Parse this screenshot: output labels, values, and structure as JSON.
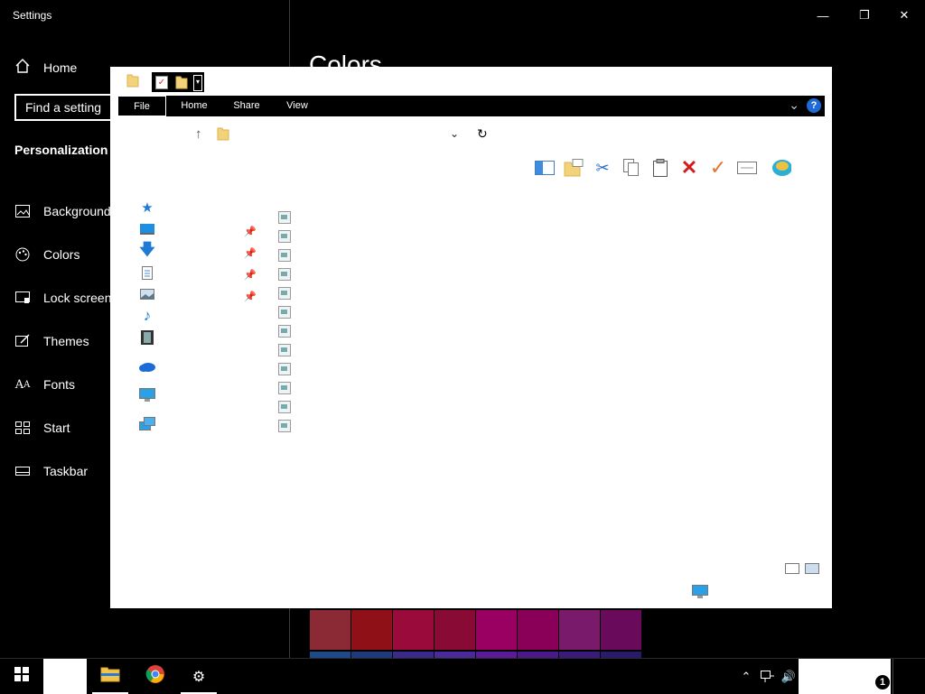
{
  "settings": {
    "title": "Settings",
    "home_label": "Home",
    "search_placeholder": "Find a setting",
    "section": "Personalization",
    "nav": [
      {
        "label": "Background",
        "icon": "image-icon"
      },
      {
        "label": "Colors",
        "icon": "palette-icon"
      },
      {
        "label": "Lock screen",
        "icon": "lock-screen-icon"
      },
      {
        "label": "Themes",
        "icon": "themes-icon"
      },
      {
        "label": "Fonts",
        "icon": "fonts-icon"
      },
      {
        "label": "Start",
        "icon": "start-icon"
      },
      {
        "label": "Taskbar",
        "icon": "taskbar-icon"
      }
    ],
    "page_heading": "Colors",
    "swatch_colors": [
      "#8b2a35",
      "#901018",
      "#9a0a3a",
      "#8a0a36",
      "#9a0062",
      "#8a0058",
      "#7a1a6a",
      "#6a0a5a"
    ],
    "swatch_colors_row2": [
      "#1e4a8a",
      "#1e3a7a",
      "#3a2a8a",
      "#4a2a9a",
      "#5a1a9a",
      "#4a1a8a",
      "#3a1a7a",
      "#2a1a6a"
    ]
  },
  "explorer": {
    "tabs": [
      "File",
      "Home",
      "Share",
      "View"
    ],
    "active_tab": "File",
    "help_label": "?",
    "toolbar_icons": [
      "navigation-pane-icon",
      "new-folder-icon",
      "cut-icon",
      "copy-icon",
      "paste-icon",
      "delete-icon",
      "checkmark-icon",
      "rename-icon",
      "shell-icon"
    ],
    "nav_items": [
      "quick-access-icon",
      "desktop-icon",
      "downloads-icon",
      "documents-icon",
      "pictures-icon",
      "music-icon",
      "videos-icon",
      "onedrive-icon",
      "this-pc-icon",
      "network-icon"
    ],
    "file_count": 12,
    "pinned_count": 4
  },
  "taskbar": {
    "apps": [
      "file-explorer-icon",
      "chrome-icon",
      "settings-gear-icon"
    ],
    "notification_count": "1"
  }
}
